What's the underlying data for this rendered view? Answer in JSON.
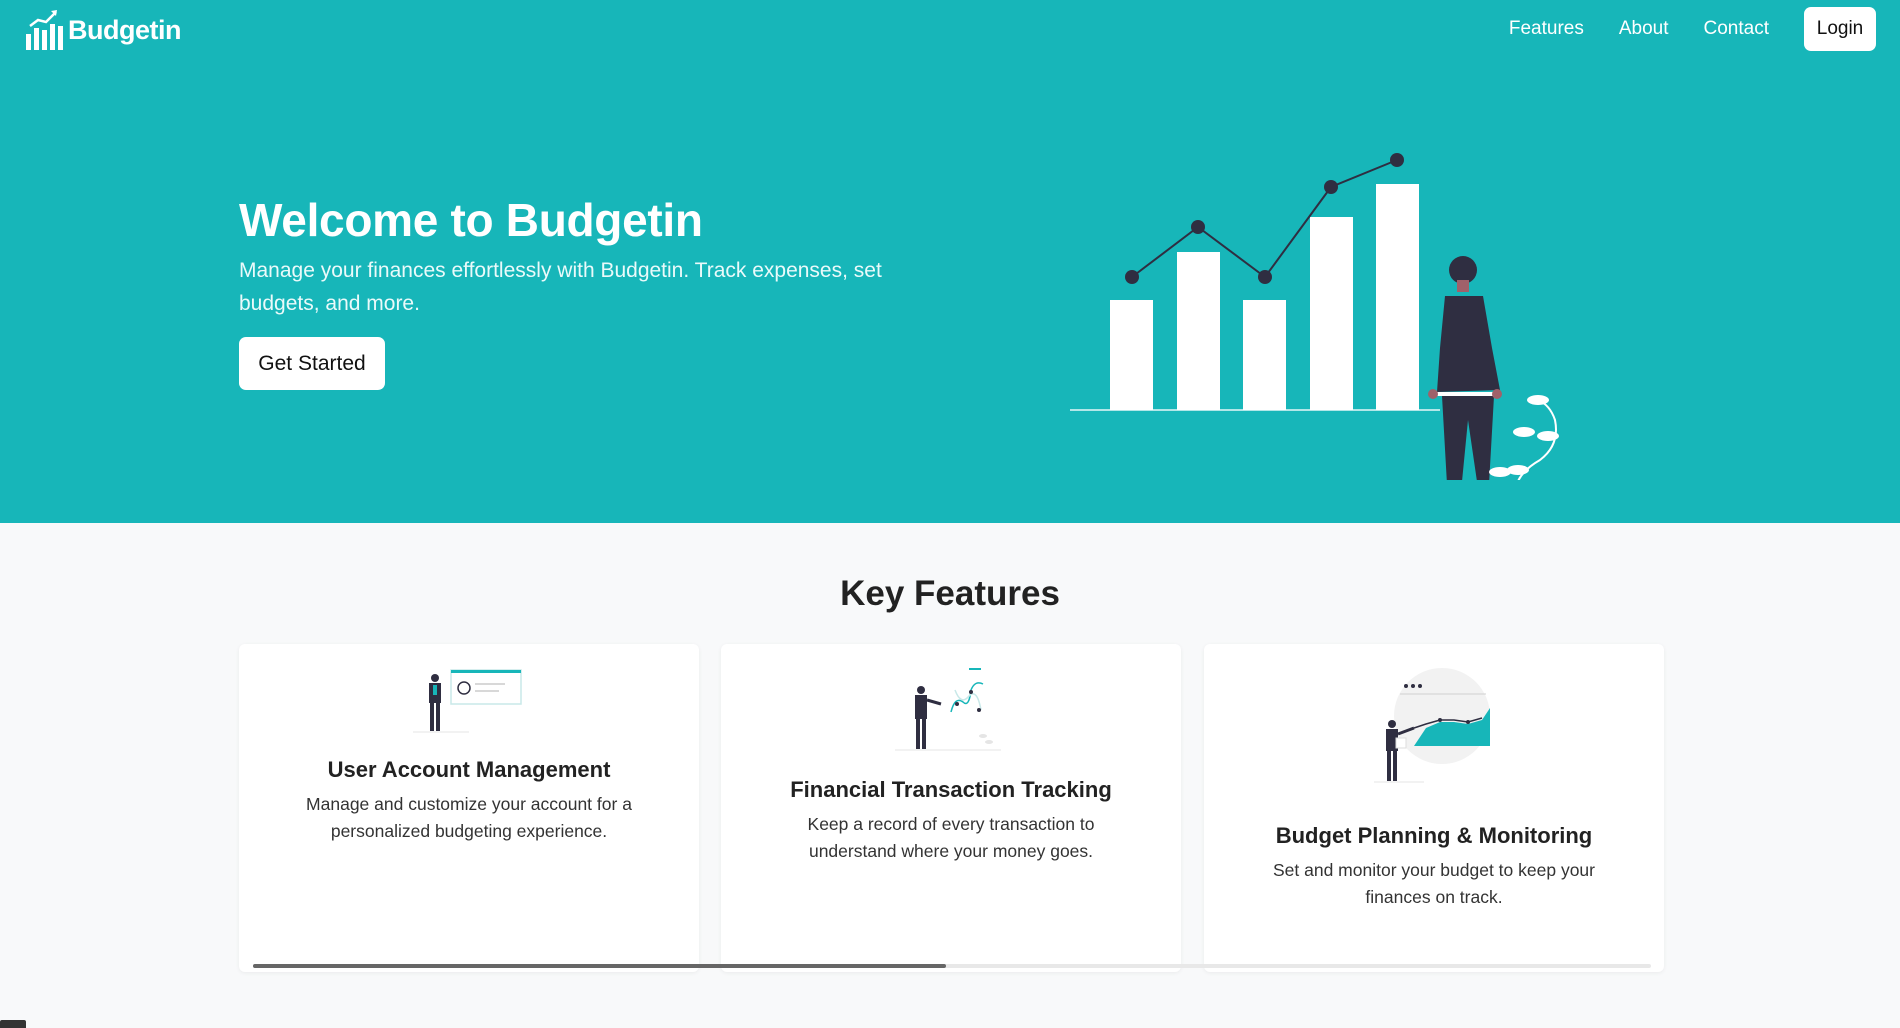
{
  "nav": {
    "brand": "Budgetin",
    "links": [
      "Features",
      "About",
      "Contact"
    ],
    "login_label": "Login"
  },
  "hero": {
    "title": "Welcome to Budgetin",
    "subtitle": "Manage your finances effortlessly with Budgetin. Track expenses, set budgets, and more.",
    "cta_label": "Get Started"
  },
  "features": {
    "heading": "Key Features",
    "cards": [
      {
        "title": "User Account Management",
        "text": "Manage and customize your account for a personalized budgeting experience.",
        "icon": "user-account-illustration"
      },
      {
        "title": "Financial Transaction Tracking",
        "text": "Keep a record of every transaction to understand where your money goes.",
        "icon": "transaction-tracking-illustration"
      },
      {
        "title": "Budget Planning & Monitoring",
        "text": "Set and monitor your budget to keep your finances on track.",
        "icon": "budget-monitoring-illustration"
      }
    ],
    "scroll_position": 0.5
  },
  "colors": {
    "primary": "#17b6b9",
    "dark": "#2f2e41",
    "background": "#f8f9fa"
  }
}
